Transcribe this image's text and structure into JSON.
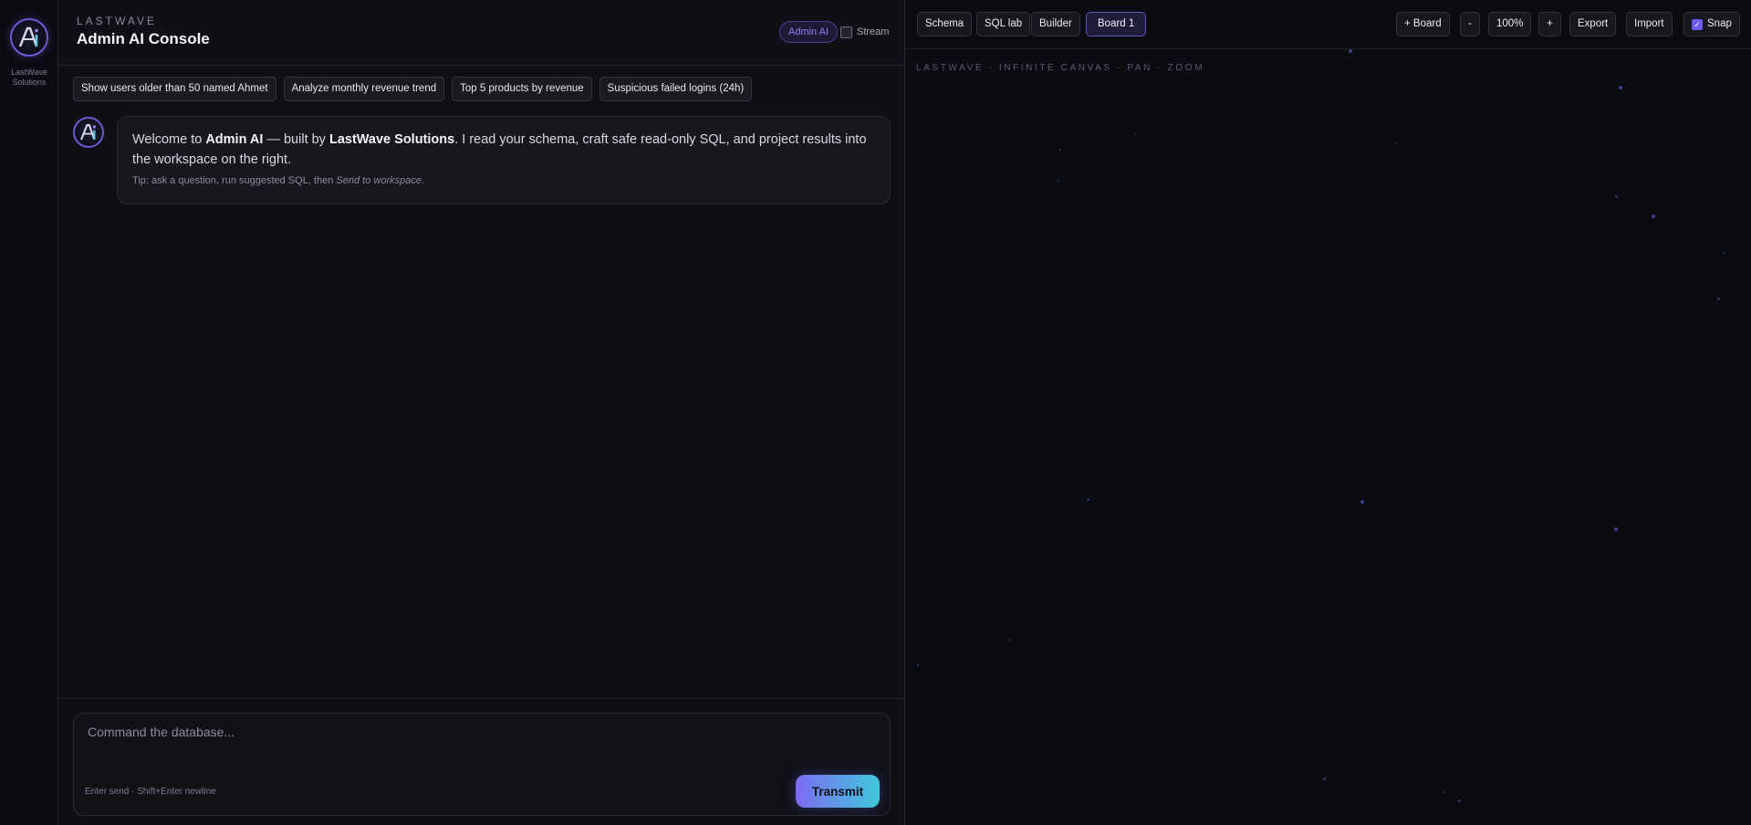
{
  "rail": {
    "brand": "LastWave Solutions"
  },
  "header": {
    "brand": "LASTWAVE",
    "title": "Admin AI Console",
    "badge": "Admin AI",
    "stream_label": "Stream"
  },
  "suggestions": [
    "Show users older than 50 named Ahmet",
    "Analyze monthly revenue trend",
    "Top 5 products by revenue",
    "Suspicious failed logins (24h)"
  ],
  "welcome": {
    "p1": "Welcome to ",
    "b1": "Admin AI",
    "p2": " — built by ",
    "b2": "LastWave Solutions",
    "p3": ". I read your schema, craft safe read-only SQL, and project results into the workspace on the right.",
    "tip_prefix": "Tip: ask a question, run suggested SQL, then ",
    "tip_em": "Send to workspace",
    "tip_suffix": "."
  },
  "composer": {
    "placeholder": "Command the database...",
    "hint": "Enter send · Shift+Enter newline",
    "send_label": "Transmit"
  },
  "workspace": {
    "tabs": [
      "Schema",
      "SQL lab",
      "Builder"
    ],
    "active_board": "Board 1",
    "add_board": "+ Board",
    "zoom_out": "-",
    "zoom_level": "100%",
    "zoom_in": "+",
    "export_label": "Export",
    "import_label": "Import",
    "snap_label": "Snap",
    "snap_checked": true,
    "caption": "LASTWAVE · INFINITE CANVAS · PAN · ZOOM"
  },
  "colors": {
    "accent": "#7d6cf2",
    "accent_cyan": "#3fc8da",
    "background": "#0d0d13"
  }
}
